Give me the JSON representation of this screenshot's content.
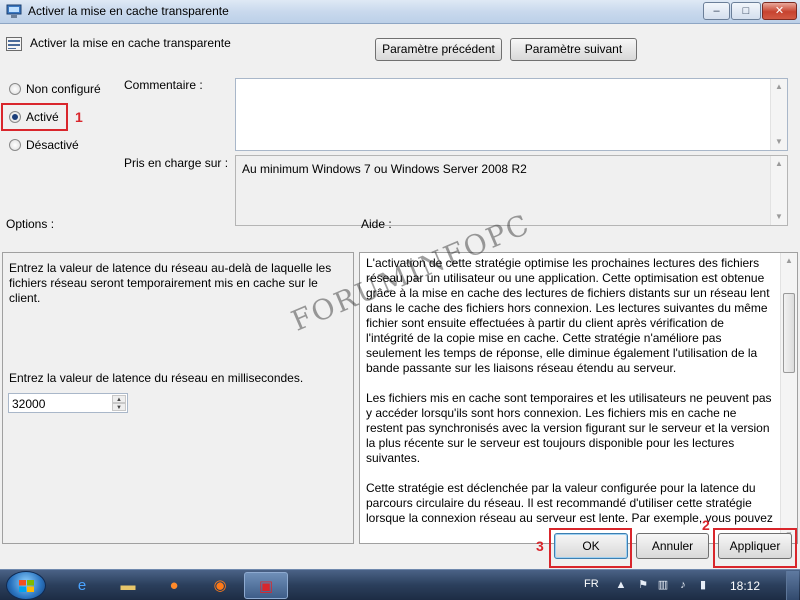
{
  "window": {
    "title": "Activer la mise en cache transparente",
    "controls": {
      "minimize": "–",
      "maximize": "□",
      "close": "✕"
    }
  },
  "header": {
    "title": "Activer la mise en cache transparente",
    "prev_button": "Paramètre précédent",
    "next_button": "Paramètre suivant"
  },
  "state": {
    "options": [
      {
        "label": "Non configuré",
        "selected": false
      },
      {
        "label": "Activé",
        "selected": true
      },
      {
        "label": "Désactivé",
        "selected": false
      }
    ]
  },
  "fields": {
    "comment_label": "Commentaire :",
    "comment_value": "",
    "support_label": "Pris en charge sur :",
    "support_value": "Au minimum Windows 7 ou Windows Server 2008 R2"
  },
  "options_panel": {
    "label": "Options :",
    "description": "Entrez la valeur de latence du réseau au-delà de laquelle les fichiers réseau seront temporairement mis en cache sur le client.",
    "latency_label": "Entrez la valeur de latence du réseau en millisecondes.",
    "latency_value": "32000"
  },
  "help_panel": {
    "label": "Aide :",
    "paragraphs": [
      "L'activation de cette stratégie optimise les prochaines lectures des fichiers réseau par un utilisateur ou une application. Cette optimisation est obtenue grâce à la mise en cache des lectures de fichiers distants sur un réseau lent dans le cache des fichiers hors connexion. Les lectures suivantes du même fichier sont ensuite effectuées à partir du client après vérification de l'intégrité de la copie mise en cache. Cette stratégie n'améliore pas seulement les temps de réponse, elle diminue également l'utilisation de la bande passante sur les liaisons réseau étendu au serveur.",
      "Les fichiers mis en cache sont temporaires et les utilisateurs ne peuvent pas y accéder lorsqu'ils sont hors connexion. Les fichiers mis en cache ne restent pas synchronisés avec la version figurant sur le serveur et la version la plus récente sur le serveur est toujours disponible pour les lectures suivantes.",
      "Cette stratégie est déclenchée par la valeur configurée pour la latence du parcours circulaire du réseau. Il est recommandé d'utiliser cette stratégie lorsque la connexion réseau au serveur est lente. Par exemple, vous pouvez"
    ]
  },
  "footer": {
    "ok": "OK",
    "cancel": "Annuler",
    "apply": "Appliquer"
  },
  "annotations": {
    "step1": "1",
    "step2": "2",
    "step3": "3",
    "color": "#d9262c"
  },
  "watermark": "FORUMINFOPC",
  "taskbar": {
    "language": "FR",
    "clock": "18:12",
    "apps": [
      "internet-explorer-icon",
      "explorer-folder-icon",
      "firefox-icon",
      "media-player-icon",
      "policy-editor-icon"
    ]
  }
}
